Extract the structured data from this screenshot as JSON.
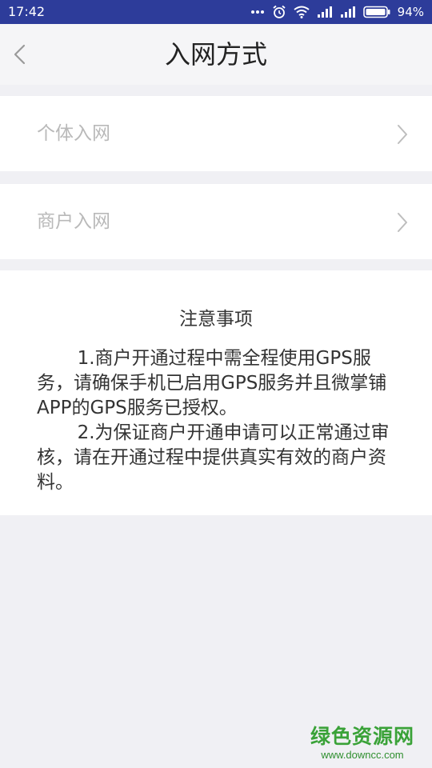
{
  "status_bar": {
    "time": "17:42",
    "battery": "94%",
    "icons": [
      "more-icon",
      "alarm-icon",
      "wifi-icon",
      "signal-icon",
      "signal-icon",
      "battery-icon"
    ]
  },
  "header": {
    "title": "入网方式",
    "back_icon": "chevron-left-icon"
  },
  "menu": {
    "items": [
      {
        "label": "个体入网",
        "icon": "chevron-right-icon"
      },
      {
        "label": "商户入网",
        "icon": "chevron-right-icon"
      }
    ]
  },
  "notice": {
    "title": "注意事项",
    "paragraphs": [
      "1.商户开通过程中需全程使用GPS服务，请确保手机已启用GPS服务并且微掌铺APP的GPS服务已授权。",
      "2.为保证商户开通申请可以正常通过审核，请在开通过程中提供真实有效的商户资料。"
    ]
  },
  "watermark": {
    "logo": "绿色资源网",
    "url": "www.downcc.com"
  },
  "colors": {
    "status_bar": "#2d3c9a",
    "background": "#f0f0f4",
    "menu_label": "#b9b9b9",
    "watermark": "#3aa238"
  }
}
